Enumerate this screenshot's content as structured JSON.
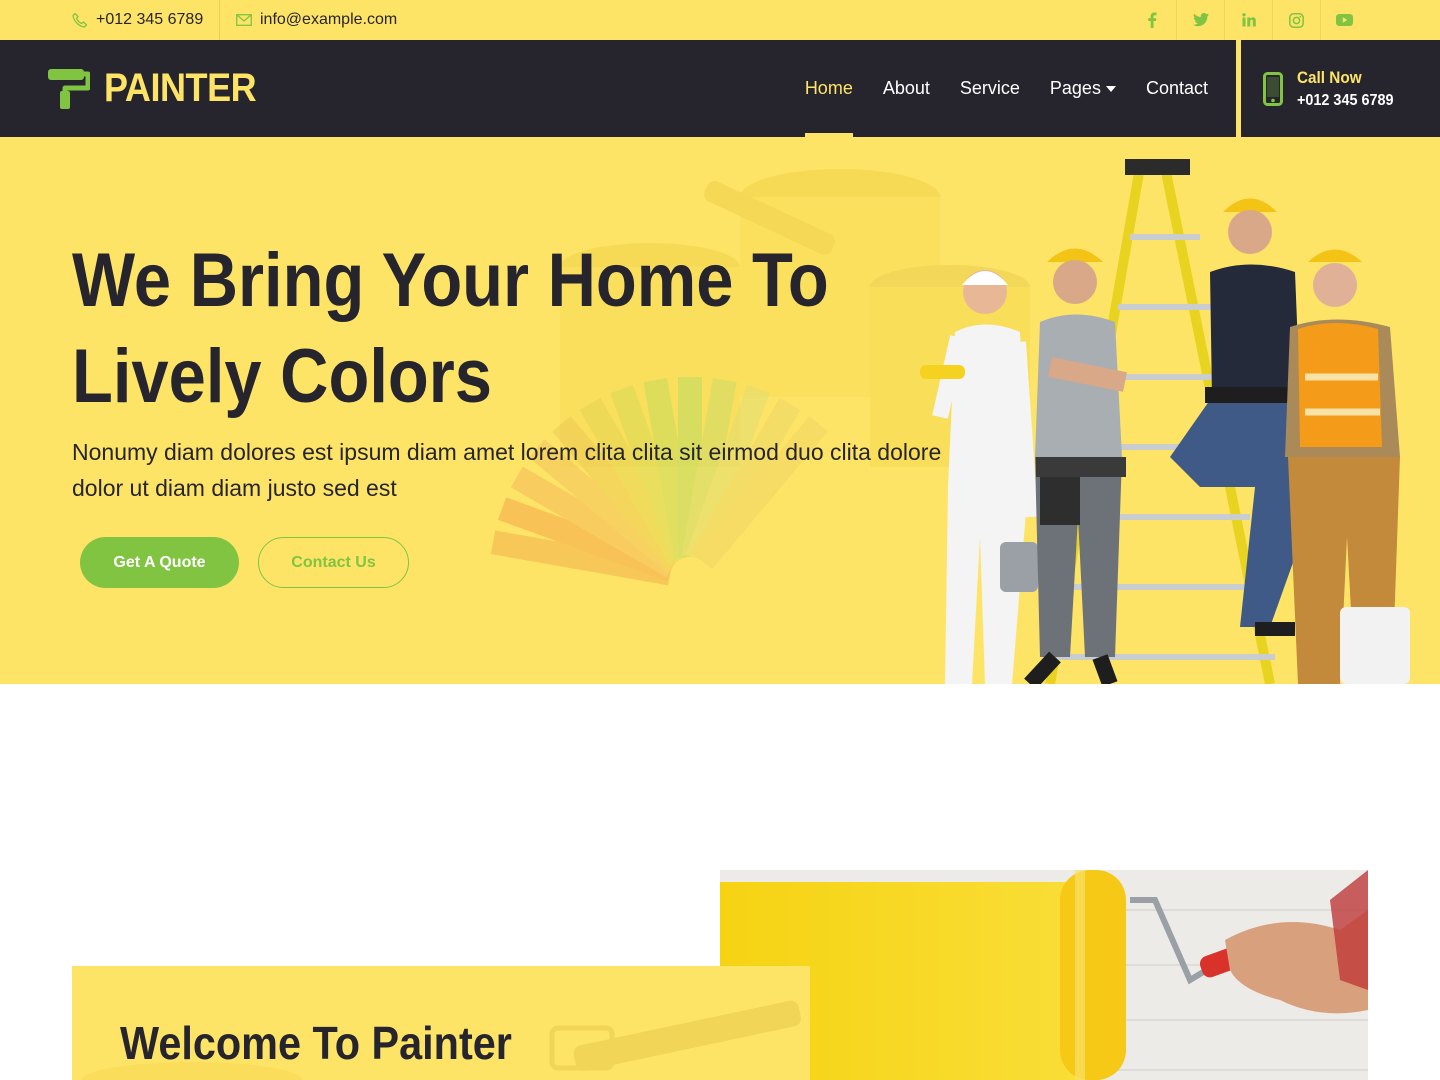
{
  "topbar": {
    "phone": "+012 345 6789",
    "email": "info@example.com",
    "socials": [
      "facebook-icon",
      "twitter-icon",
      "linkedin-icon",
      "instagram-icon",
      "youtube-icon"
    ]
  },
  "navbar": {
    "brand": "PAINTER",
    "items": [
      {
        "label": "Home",
        "active": true
      },
      {
        "label": "About"
      },
      {
        "label": "Service"
      },
      {
        "label": "Pages"
      },
      {
        "label": "Contact"
      }
    ],
    "call_label": "Call Now",
    "call_number": "+012 345 6789"
  },
  "hero": {
    "title_line1": "We Bring Your Home To",
    "title_line2": "Lively Colors",
    "text": "Nonumy diam dolores est ipsum diam amet lorem clita clita sit eirmod duo clita dolore dolor ut diam diam justo sed est",
    "quote_button": "Get A Quote",
    "contact_button": "Contact Us"
  },
  "about": {
    "title": "Welcome To Painter"
  },
  "colors": {
    "accent_yellow": "#fee466",
    "dark": "#26252e",
    "green": "#81c442"
  }
}
